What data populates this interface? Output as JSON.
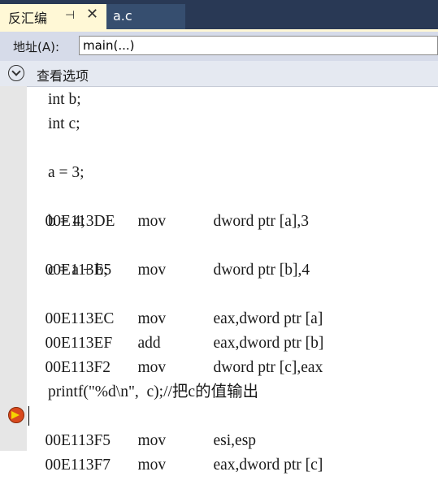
{
  "tabs": [
    {
      "label": "反汇编",
      "pin_glyph": "⊣",
      "close_glyph": "✕"
    },
    {
      "label": "a.c"
    }
  ],
  "address_bar": {
    "label": "地址(A):",
    "value": "main(...)"
  },
  "view_options": {
    "label": "查看选项",
    "icon": "chevron-down-circle-icon"
  },
  "code_lines": [
    {
      "kind": "src",
      "text": "int b;"
    },
    {
      "kind": "src",
      "text": "int c;"
    },
    {
      "kind": "blank",
      "text": ""
    },
    {
      "kind": "src",
      "text": "a = 3;"
    },
    {
      "kind": "asm",
      "address": "00E113DE",
      "mnemonic": "mov",
      "operands": "dword ptr [a],3"
    },
    {
      "kind": "src",
      "text": "b = 4;"
    },
    {
      "kind": "asm",
      "address": "00E113E5",
      "mnemonic": "mov",
      "operands": "dword ptr [b],4"
    },
    {
      "kind": "src",
      "text": "c = a + b;"
    },
    {
      "kind": "asm",
      "address": "00E113EC",
      "mnemonic": "mov",
      "operands": "eax,dword ptr [a]"
    },
    {
      "kind": "asm",
      "address": "00E113EF",
      "mnemonic": "add",
      "operands": "eax,dword ptr [b]"
    },
    {
      "kind": "asm",
      "address": "00E113F2",
      "mnemonic": "mov",
      "operands": "dword ptr [c],eax"
    },
    {
      "kind": "blank",
      "text": ""
    },
    {
      "kind": "src",
      "text": "printf(\"%d\\n\",  c);//把c的值输出"
    },
    {
      "kind": "asm",
      "address": "00E113F5",
      "mnemonic": "mov",
      "operands": "esi,esp",
      "current": true
    },
    {
      "kind": "asm",
      "address": "00E113F7",
      "mnemonic": "mov",
      "operands": "eax,dword ptr [c]"
    }
  ],
  "colors": {
    "tab_bar": "#293955",
    "active_tab": "#fff8d6",
    "gutter": "#e6e6e6",
    "breakpoint": "#d94a1e",
    "instruction_pointer": "#f5d400"
  }
}
